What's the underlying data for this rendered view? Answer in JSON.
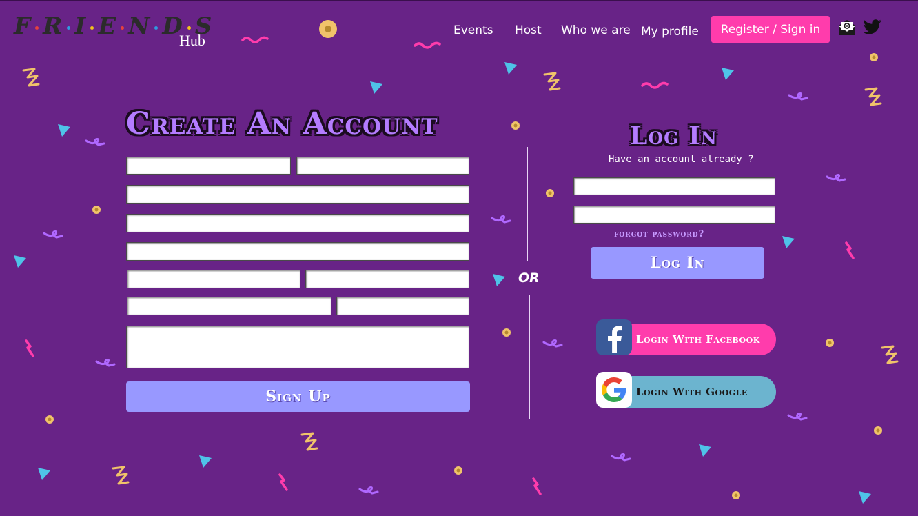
{
  "logo": {
    "letters": [
      "F",
      "R",
      "I",
      "E",
      "N",
      "D",
      "S"
    ],
    "dot_colors": [
      "#e8423c",
      "#2f9be0",
      "#f2c21b",
      "#e8423c",
      "#2f9be0",
      "#f2c21b"
    ],
    "sub": "Hub"
  },
  "nav": {
    "links": [
      "Events",
      "Host",
      "Who we are",
      "My profile"
    ],
    "register": "Register / Sign in"
  },
  "icons": {
    "mail": "mail-icon",
    "twitter": "twitter-icon"
  },
  "signup": {
    "title": "Create An Account",
    "button": "Sign Up"
  },
  "divider": {
    "or": "OR"
  },
  "login": {
    "title": "Log In",
    "subtitle": "Have an account already ?",
    "forgot": "forgot password?",
    "button": "Log In",
    "facebook": "Login With Facebook",
    "google": "Login With Google"
  },
  "colors": {
    "background": "#682387",
    "accent_pink": "#ff3cac",
    "button_lavender": "#9898ff",
    "title_purple": "#b47cff",
    "google_button": "#6cb4cf"
  }
}
